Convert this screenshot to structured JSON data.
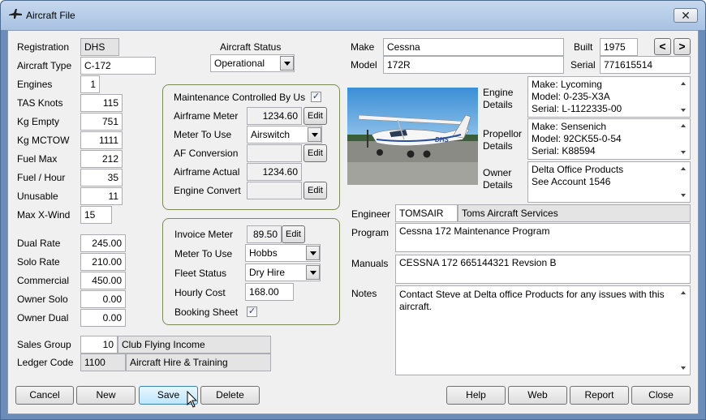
{
  "window": {
    "title": "Aircraft File",
    "close_glyph": "✕"
  },
  "left": {
    "registration_label": "Registration",
    "registration": "DHS",
    "aircraft_type_label": "Aircraft Type",
    "aircraft_type": "C-172",
    "engines_label": "Engines",
    "engines": "1",
    "tas_label": "TAS Knots",
    "tas": "115",
    "kg_empty_label": "Kg Empty",
    "kg_empty": "751",
    "kg_mctow_label": "Kg MCTOW",
    "kg_mctow": "1111",
    "fuel_max_label": "Fuel Max",
    "fuel_max": "212",
    "fuel_hour_label": "Fuel / Hour",
    "fuel_hour": "35",
    "unusable_label": "Unusable",
    "unusable": "11",
    "max_xwind_label": "Max X-Wind",
    "max_xwind": "15",
    "dual_rate_label": "Dual Rate",
    "dual_rate": "245.00",
    "solo_rate_label": "Solo Rate",
    "solo_rate": "210.00",
    "commercial_label": "Commercial",
    "commercial": "450.00",
    "owner_solo_label": "Owner Solo",
    "owner_solo": "0.00",
    "owner_dual_label": "Owner Dual",
    "owner_dual": "0.00",
    "sales_group_label": "Sales Group",
    "sales_group_code": "10",
    "sales_group_name": "Club Flying Income",
    "ledger_code_label": "Ledger Code",
    "ledger_code": "1100",
    "ledger_name": "Aircraft Hire & Training"
  },
  "status": {
    "label": "Aircraft Status",
    "value": "Operational"
  },
  "maintenance": {
    "controlled_label": "Maintenance Controlled By Us",
    "controlled_checked": true,
    "airframe_meter_label": "Airframe Meter",
    "airframe_meter": "1234.60",
    "meter_to_use_label": "Meter To Use",
    "meter_to_use": "Airswitch",
    "af_conversion_label": "AF Conversion",
    "af_conversion": "",
    "airframe_actual_label": "Airframe Actual",
    "airframe_actual": "1234.60",
    "engine_convert_label": "Engine Convert",
    "engine_convert": "",
    "edit_label": "Edit"
  },
  "invoice": {
    "invoice_meter_label": "Invoice Meter",
    "invoice_meter": "89.50",
    "meter_to_use_label": "Meter To Use",
    "meter_to_use": "Hobbs",
    "fleet_status_label": "Fleet Status",
    "fleet_status": "Dry Hire",
    "hourly_cost_label": "Hourly Cost",
    "hourly_cost": "168.00",
    "booking_sheet_label": "Booking Sheet",
    "booking_sheet_checked": true,
    "edit_label": "Edit"
  },
  "right": {
    "make_label": "Make",
    "make": "Cessna",
    "model_label": "Model",
    "model": "172R",
    "built_label": "Built",
    "built": "1975",
    "serial_label": "Serial",
    "serial": "771615514",
    "prev_glyph": "<",
    "next_glyph": ">",
    "photo_tail": "DHS",
    "engine_details_label_1": "Engine",
    "engine_details_label_2": "Details",
    "engine_details": [
      "Make: Lycoming",
      "Model: 0-235-X3A",
      "Serial: L-1122335-00"
    ],
    "propellor_label_1": "Propellor",
    "propellor_label_2": "Details",
    "propellor_details": [
      "Make: Sensenich",
      "Model: 92CK55-0-54",
      "Serial: K88594"
    ],
    "owner_label_1": "Owner",
    "owner_label_2": "Details",
    "owner_details": [
      "Delta Office Products",
      "See Account 1546"
    ],
    "engineer_label": "Engineer",
    "engineer_code": "TOMSAIR",
    "engineer_name": "Toms Aircraft Services",
    "program_label": "Program",
    "program": "Cessna 172 Maintenance Program",
    "manuals_label": "Manuals",
    "manuals": "CESSNA 172 665144321 Revsion B",
    "notes_label": "Notes",
    "notes": "Contact Steve at Delta office Products for any issues with this aircraft."
  },
  "buttons": {
    "cancel": "Cancel",
    "new": "New",
    "save": "Save",
    "delete": "Delete",
    "help": "Help",
    "web": "Web",
    "report": "Report",
    "close": "Close"
  }
}
